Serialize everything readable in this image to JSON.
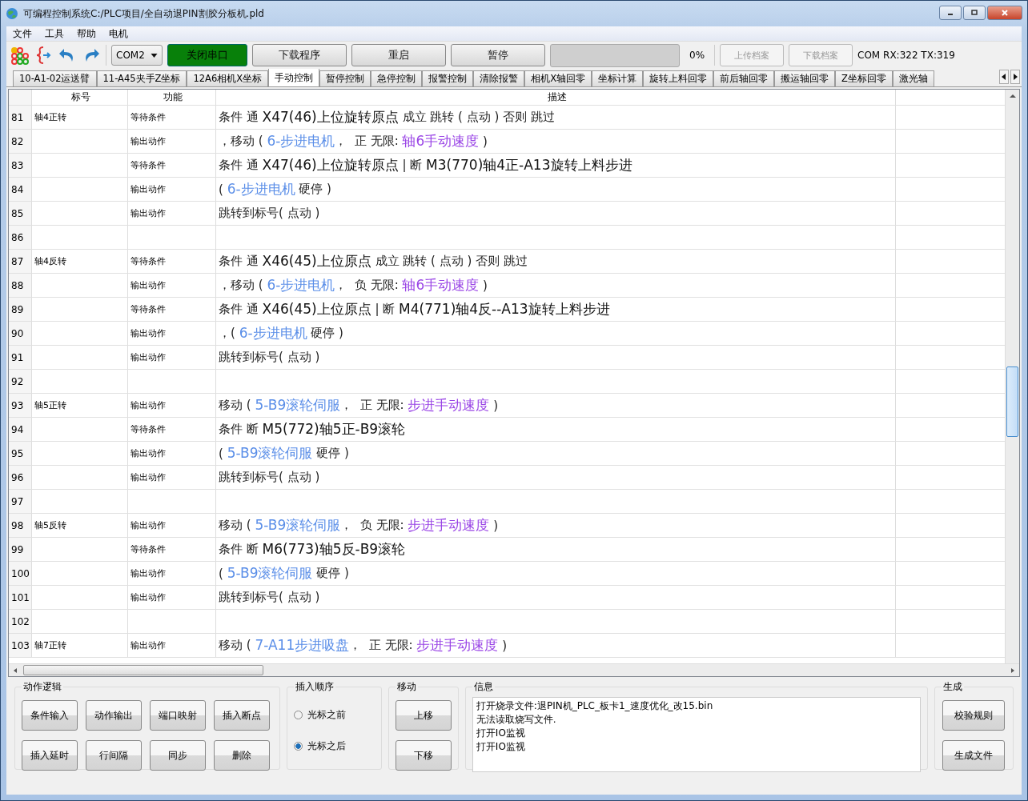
{
  "window": {
    "title": "可编程控制系统C:/PLC项目/全自动退PIN割胶分板机.pld"
  },
  "menu": [
    "文件",
    "工具",
    "帮助",
    "电机"
  ],
  "toolbar": {
    "port": "COM2",
    "buttons": [
      {
        "label": "关闭串口",
        "kind": "connect"
      },
      {
        "label": "下载程序",
        "kind": "normal"
      },
      {
        "label": "重启",
        "kind": "normal"
      },
      {
        "label": "暂停",
        "kind": "normal"
      }
    ],
    "progress": {
      "level": 0,
      "reading": "0%"
    },
    "file_buttons": [
      {
        "label": "上传档案",
        "disabled": true
      },
      {
        "label": "下载档案",
        "disabled": true
      }
    ],
    "status": "COM RX:322 TX:319"
  },
  "tabs": [
    {
      "label": "10-A1-02运送臂",
      "selected": false
    },
    {
      "label": "11-A45夹手Z坐标",
      "selected": false
    },
    {
      "label": "12A6相机X坐标",
      "selected": false
    },
    {
      "label": "手动控制",
      "selected": true
    },
    {
      "label": "暂停控制",
      "selected": false
    },
    {
      "label": "急停控制",
      "selected": false
    },
    {
      "label": "报警控制",
      "selected": false
    },
    {
      "label": "清除报警",
      "selected": false
    },
    {
      "label": "相机X轴回零",
      "selected": false
    },
    {
      "label": "坐标计算",
      "selected": false
    },
    {
      "label": "旋转上料回零",
      "selected": false
    },
    {
      "label": "前后轴回零",
      "selected": false
    },
    {
      "label": "搬运轴回零",
      "selected": false
    },
    {
      "label": "Z坐标回零",
      "selected": false
    },
    {
      "label": "激光轴",
      "selected": false
    }
  ],
  "table": {
    "columns": [
      "标号",
      "功能",
      "描述"
    ],
    "rows": [
      {
        "num": "81",
        "label": "轴4正转",
        "function": "等待条件",
        "description": [
          {
            "kind": "plain",
            "text": "条件 通 "
          },
          {
            "kind": "big",
            "text": "X47(46)上位旋转原点"
          },
          {
            "kind": "plain",
            "text": " 成立 跳转 ( 点动 ) 否则 跳过"
          }
        ]
      },
      {
        "num": "82",
        "function": "输出动作",
        "description": [
          {
            "kind": "plain",
            "text": "，移动 ( "
          },
          {
            "kind": "device",
            "text": "6-步进电机"
          },
          {
            "kind": "plain",
            "text": "，  正 无限: "
          },
          {
            "kind": "variable",
            "text": "轴6手动速度"
          },
          {
            "kind": "plain",
            "text": " )"
          }
        ]
      },
      {
        "num": "83",
        "function": "等待条件",
        "description": [
          {
            "kind": "plain",
            "text": "条件 通 "
          },
          {
            "kind": "big",
            "text": "X47(46)上位旋转原点"
          },
          {
            "kind": "plain",
            "text": " | 断 "
          },
          {
            "kind": "big",
            "text": "M3(770)轴4正-A13旋转上料步进"
          }
        ]
      },
      {
        "num": "84",
        "function": "输出动作",
        "description": [
          {
            "kind": "plain",
            "text": "( "
          },
          {
            "kind": "device",
            "text": "6-步进电机"
          },
          {
            "kind": "plain",
            "text": " 硬停 )"
          }
        ]
      },
      {
        "num": "85",
        "function": "输出动作",
        "description": [
          {
            "kind": "plain",
            "text": "跳转到标号( 点动 )"
          }
        ]
      },
      {
        "num": "86"
      },
      {
        "num": "87",
        "label": "轴4反转",
        "function": "等待条件",
        "description": [
          {
            "kind": "plain",
            "text": "条件 通 "
          },
          {
            "kind": "big",
            "text": "X46(45)上位原点"
          },
          {
            "kind": "plain",
            "text": " 成立 跳转 ( 点动 ) 否则 跳过"
          }
        ]
      },
      {
        "num": "88",
        "function": "输出动作",
        "description": [
          {
            "kind": "plain",
            "text": "，移动 ( "
          },
          {
            "kind": "device",
            "text": "6-步进电机"
          },
          {
            "kind": "plain",
            "text": "，  负 无限: "
          },
          {
            "kind": "variable",
            "text": "轴6手动速度"
          },
          {
            "kind": "plain",
            "text": " )"
          }
        ]
      },
      {
        "num": "89",
        "function": "等待条件",
        "description": [
          {
            "kind": "plain",
            "text": "条件 通 "
          },
          {
            "kind": "big",
            "text": "X46(45)上位原点"
          },
          {
            "kind": "plain",
            "text": " | 断 "
          },
          {
            "kind": "big",
            "text": "M4(771)轴4反--A13旋转上料步进"
          }
        ]
      },
      {
        "num": "90",
        "function": "输出动作",
        "description": [
          {
            "kind": "plain",
            "text": "，( "
          },
          {
            "kind": "device",
            "text": "6-步进电机"
          },
          {
            "kind": "plain",
            "text": " 硬停 )"
          }
        ]
      },
      {
        "num": "91",
        "function": "输出动作",
        "description": [
          {
            "kind": "plain",
            "text": "跳转到标号( 点动 )"
          }
        ]
      },
      {
        "num": "92"
      },
      {
        "num": "93",
        "label": "轴5正转",
        "function": "输出动作",
        "description": [
          {
            "kind": "plain",
            "text": "移动 ( "
          },
          {
            "kind": "device",
            "text": "5-B9滚轮伺服"
          },
          {
            "kind": "plain",
            "text": "，  正 无限: "
          },
          {
            "kind": "variable",
            "text": "步进手动速度"
          },
          {
            "kind": "plain",
            "text": " )"
          }
        ]
      },
      {
        "num": "94",
        "function": "等待条件",
        "description": [
          {
            "kind": "plain",
            "text": "条件 断 "
          },
          {
            "kind": "big",
            "text": "M5(772)轴5正-B9滚轮"
          }
        ]
      },
      {
        "num": "95",
        "function": "输出动作",
        "description": [
          {
            "kind": "plain",
            "text": "( "
          },
          {
            "kind": "device",
            "text": "5-B9滚轮伺服"
          },
          {
            "kind": "plain",
            "text": " 硬停 )"
          }
        ]
      },
      {
        "num": "96",
        "function": "输出动作",
        "description": [
          {
            "kind": "plain",
            "text": "跳转到标号( 点动 )"
          }
        ]
      },
      {
        "num": "97"
      },
      {
        "num": "98",
        "label": "轴5反转",
        "function": "输出动作",
        "description": [
          {
            "kind": "plain",
            "text": "移动 ( "
          },
          {
            "kind": "device",
            "text": "5-B9滚轮伺服"
          },
          {
            "kind": "plain",
            "text": "，  负 无限: "
          },
          {
            "kind": "variable",
            "text": "步进手动速度"
          },
          {
            "kind": "plain",
            "text": " )"
          }
        ]
      },
      {
        "num": "99",
        "function": "等待条件",
        "description": [
          {
            "kind": "plain",
            "text": "条件 断 "
          },
          {
            "kind": "big",
            "text": "M6(773)轴5反-B9滚轮"
          }
        ]
      },
      {
        "num": "100",
        "function": "输出动作",
        "description": [
          {
            "kind": "plain",
            "text": "( "
          },
          {
            "kind": "device",
            "text": "5-B9滚轮伺服"
          },
          {
            "kind": "plain",
            "text": " 硬停 )"
          }
        ]
      },
      {
        "num": "101",
        "function": "输出动作",
        "description": [
          {
            "kind": "plain",
            "text": "跳转到标号( 点动 )"
          }
        ]
      },
      {
        "num": "102"
      },
      {
        "num": "103",
        "label": "轴7正转",
        "function": "输出动作",
        "description": [
          {
            "kind": "plain",
            "text": "移动 ( "
          },
          {
            "kind": "device",
            "text": "7-A11步进吸盘"
          },
          {
            "kind": "plain",
            "text": "，  正 无限: "
          },
          {
            "kind": "variable",
            "text": "步进手动速度"
          },
          {
            "kind": "plain",
            "text": " )"
          }
        ]
      }
    ]
  },
  "action_logic": {
    "title": "动作逻辑",
    "buttons": [
      "条件输入",
      "动作输出",
      "端口映射",
      "插入断点",
      "插入延时",
      "行间隔",
      "同步",
      "删除"
    ]
  },
  "insert_order": {
    "title": "插入顺序",
    "options": [
      {
        "label": "光标之前",
        "selected": false
      },
      {
        "label": "光标之后",
        "selected": true
      }
    ]
  },
  "move": {
    "title": "移动",
    "buttons": [
      "上移",
      "下移"
    ]
  },
  "info": {
    "title": "信息",
    "lines": [
      "打开烧录文件:退PIN机_PLC_板卡1_速度优化_改15.bin",
      "无法读取烧写文件.",
      "打开IO监视",
      "打开IO监视"
    ]
  },
  "generate": {
    "title": "生成",
    "buttons": [
      "校验规则",
      "生成文件"
    ]
  }
}
